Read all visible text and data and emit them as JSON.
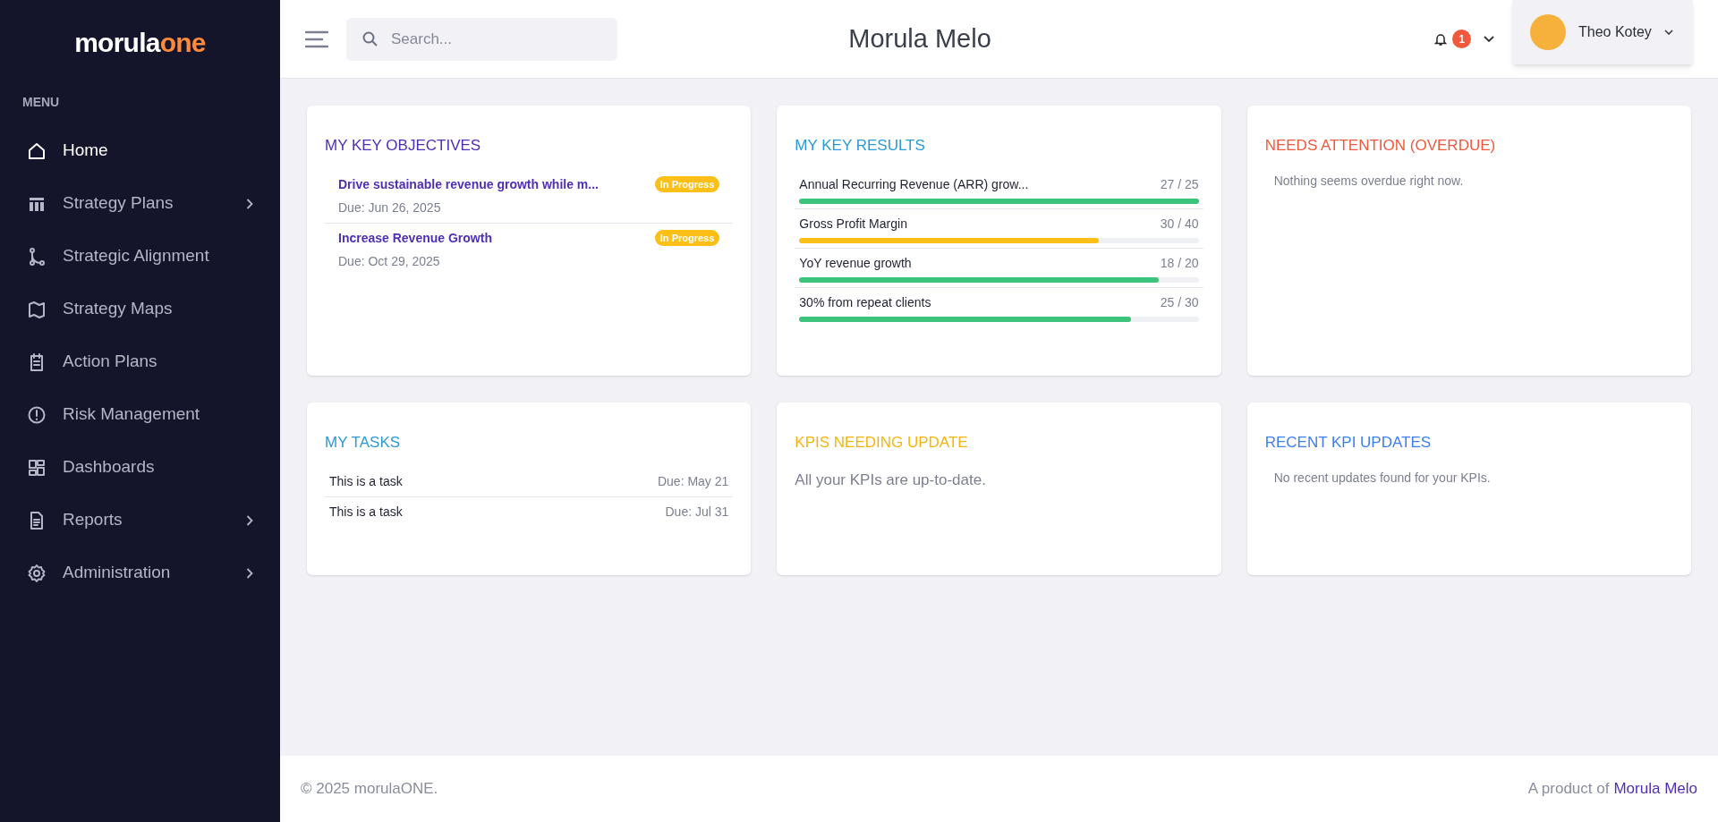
{
  "logo": {
    "text": "morula",
    "accent": "one"
  },
  "sidebar": {
    "heading": "MENU",
    "items": [
      {
        "label": "Home",
        "kind": "home",
        "selected": true,
        "expandable": false
      },
      {
        "label": "Strategy Plans",
        "kind": "plans",
        "selected": false,
        "expandable": true
      },
      {
        "label": "Strategic Alignment",
        "kind": "alignment",
        "selected": false,
        "expandable": false
      },
      {
        "label": "Strategy Maps",
        "kind": "maps",
        "selected": false,
        "expandable": false
      },
      {
        "label": "Action Plans",
        "kind": "actions",
        "selected": false,
        "expandable": false
      },
      {
        "label": "Risk Management",
        "kind": "risk",
        "selected": false,
        "expandable": false
      },
      {
        "label": "Dashboards",
        "kind": "dashboards",
        "selected": false,
        "expandable": false
      },
      {
        "label": "Reports",
        "kind": "reports",
        "selected": false,
        "expandable": true
      },
      {
        "label": "Administration",
        "kind": "admin",
        "selected": false,
        "expandable": true
      }
    ]
  },
  "header": {
    "search": {
      "placeholder": "Search..."
    },
    "title": "Morula Melo",
    "notifications": "1",
    "user": "Theo Kotey"
  },
  "cards": [
    {
      "kind": "objectives",
      "title": "MY KEY OBJECTIVES",
      "color": "#4f2fb8",
      "items": [
        {
          "title": "Drive sustainable revenue growth while m...",
          "due": "Due: Jun 26, 2025",
          "status": "In Progress"
        },
        {
          "title": "Increase Revenue Growth",
          "due": "Due: Oct 29, 2025",
          "status": "In Progress"
        }
      ]
    },
    {
      "kind": "results",
      "title": "MY KEY RESULTS",
      "color": "#2b9ad8",
      "items": [
        {
          "name": "Annual Recurring Revenue (ARR) grow...",
          "reading": "27 / 25",
          "level": 1,
          "color": "#3cc47c"
        },
        {
          "name": "Gross Profit Margin",
          "reading": "30 / 40",
          "level": 0.75,
          "color": "#fbbf17"
        },
        {
          "name": "YoY revenue growth",
          "reading": "18 / 20",
          "level": 0.9,
          "color": "#3cc47c"
        },
        {
          "name": "30% from repeat clients",
          "reading": "25 / 30",
          "level": 0.83,
          "color": "#3cc47c"
        }
      ]
    },
    {
      "kind": "message",
      "title": "NEEDS ATTENTION (OVERDUE)",
      "color": "#f0593e",
      "message": "Nothing seems overdue right now."
    },
    {
      "kind": "tasks",
      "title": "MY TASKS",
      "color": "#2b9ad8",
      "items": [
        {
          "name": "This is a task",
          "due": "Due: May 21"
        },
        {
          "name": "This is a task",
          "due": "Due: Jul 31"
        }
      ]
    },
    {
      "kind": "message_large",
      "title": "KPIS NEEDING UPDATE",
      "color": "#f5b511",
      "message": "All your KPIs are up-to-date."
    },
    {
      "kind": "message",
      "title": "RECENT KPI UPDATES",
      "color": "#3b7ff0",
      "message": "No recent updates found for your KPIs."
    }
  ],
  "footer": {
    "copyright": "© 2025 morulaONE.",
    "product_text": "A product of",
    "product_link": "Morula Melo"
  }
}
